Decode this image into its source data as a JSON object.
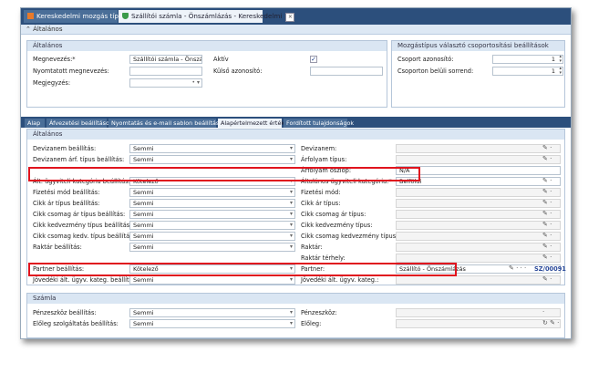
{
  "window_tabs": [
    {
      "label": "Kereskedelmi mozgás típus",
      "active": false
    },
    {
      "label": "Szállítói számla - Önszámlázás - Kereskedelmi",
      "active": true
    }
  ],
  "section_title": "Általános",
  "general_group": {
    "title": "Általános",
    "name_label": "Megnevezés:*",
    "name_value": "Szállítói számla - Önszámlázás",
    "printed_name_label": "Nyomtatott megnevezés:",
    "printed_name_value": "",
    "note_label": "Megjegyzés:",
    "note_value": "",
    "active_label": "Aktív",
    "active_checked": true,
    "external_id_label": "Külső azonosító:",
    "external_id_value": ""
  },
  "group_settings": {
    "title": "Mozgástípus választó csoportosítási beállítások",
    "group_id_label": "Csoport azonosító:",
    "group_id_value": "1",
    "group_order_label": "Csoporton belüli sorrend:",
    "group_order_value": "1"
  },
  "property_tabs": [
    "Alap",
    "Áfvezetési beállítások",
    "Nyomtatás és e-mail sablon beállítások",
    "Alapértelmezett értékek",
    "Fordított tulajdonságok"
  ],
  "active_property_tab": "Alapértelmezett értékek",
  "defaults_group": {
    "title": "Általános",
    "rows": [
      {
        "left_label": "Devizanem beállítás:",
        "left_value": "Semmi",
        "right_label": "Devizanem:",
        "right_value": "",
        "right_icons": "✎ ·"
      },
      {
        "left_label": "Devizanem árf. típus beállítás:",
        "left_value": "Semmi",
        "right_label": "Árfolyam típus:",
        "right_value": "",
        "right_icons": "✎ ·"
      },
      {
        "left_label": "",
        "left_value": "",
        "right_label": "Árfolyam oszlop:",
        "right_value": "N/A",
        "right_icons": ""
      },
      {
        "left_label": "Ált. ügyviteli kategória beállítás:",
        "left_value": "Kötelező",
        "right_label": "Általános ügyviteli kategória:*",
        "right_value": "Belföldi",
        "right_icons": "✎ ·"
      },
      {
        "left_label": "Fizetési mód beállítás:",
        "left_value": "Semmi",
        "right_label": "Fizetési mód:",
        "right_value": "",
        "right_icons": "✎ ·"
      },
      {
        "left_label": "Cikk ár típus beállítás:",
        "left_value": "Semmi",
        "right_label": "Cikk ár típus:",
        "right_value": "",
        "right_icons": "✎ ·"
      },
      {
        "left_label": "Cikk csomag ár típus beállítás:",
        "left_value": "Semmi",
        "right_label": "Cikk csomag ár típus:",
        "right_value": "",
        "right_icons": "✎ ·"
      },
      {
        "left_label": "Cikk kedvezmény típus beállítás:",
        "left_value": "Semmi",
        "right_label": "Cikk kedvezmény típus:",
        "right_value": "",
        "right_icons": "✎ ·"
      },
      {
        "left_label": "Cikk csomag kedv. típus beállítás:",
        "left_value": "Semmi",
        "right_label": "Cikk csomag kedvezmény típus:",
        "right_value": "",
        "right_icons": "✎ ·"
      },
      {
        "left_label": "Raktár beállítás:",
        "left_value": "Semmi",
        "right_label": "Raktár:",
        "right_value": "",
        "right_icons": "✎ ·"
      },
      {
        "left_label": "",
        "left_value": "",
        "right_label": "Raktár térhely:",
        "right_value": "",
        "right_icons": "✎ ·"
      },
      {
        "left_label": "Partner beállítás:",
        "left_value": "Kötelező",
        "right_label": "Partner:",
        "right_value": "Szállító - Önszámlázás",
        "right_icons": "✎ · · ·",
        "right_code": "SZ/00091"
      },
      {
        "left_label": "Jövedéki ált. ügyv. kateg. beállítás:",
        "left_value": "Semmi",
        "right_label": "Jövedéki ált. ügyv. kateg.:",
        "right_value": "",
        "right_icons": "✎ ·"
      }
    ]
  },
  "account_group": {
    "title": "Számla",
    "rows": [
      {
        "left_label": "Pénzeszköz beállítás:",
        "left_value": "Semmi",
        "right_label": "Pénzeszköz:",
        "right_value": "",
        "right_icons": "·"
      },
      {
        "left_label": "Előleg szolgáltatás beállítás:",
        "left_value": "Semmi",
        "right_label": "Előleg:",
        "right_value": "",
        "right_icons": "↻ ✎ ·"
      }
    ]
  },
  "colors": {
    "tabbar": "#2c4f7c",
    "highlight": "#e0141e",
    "group_header": "#dae6f3"
  }
}
